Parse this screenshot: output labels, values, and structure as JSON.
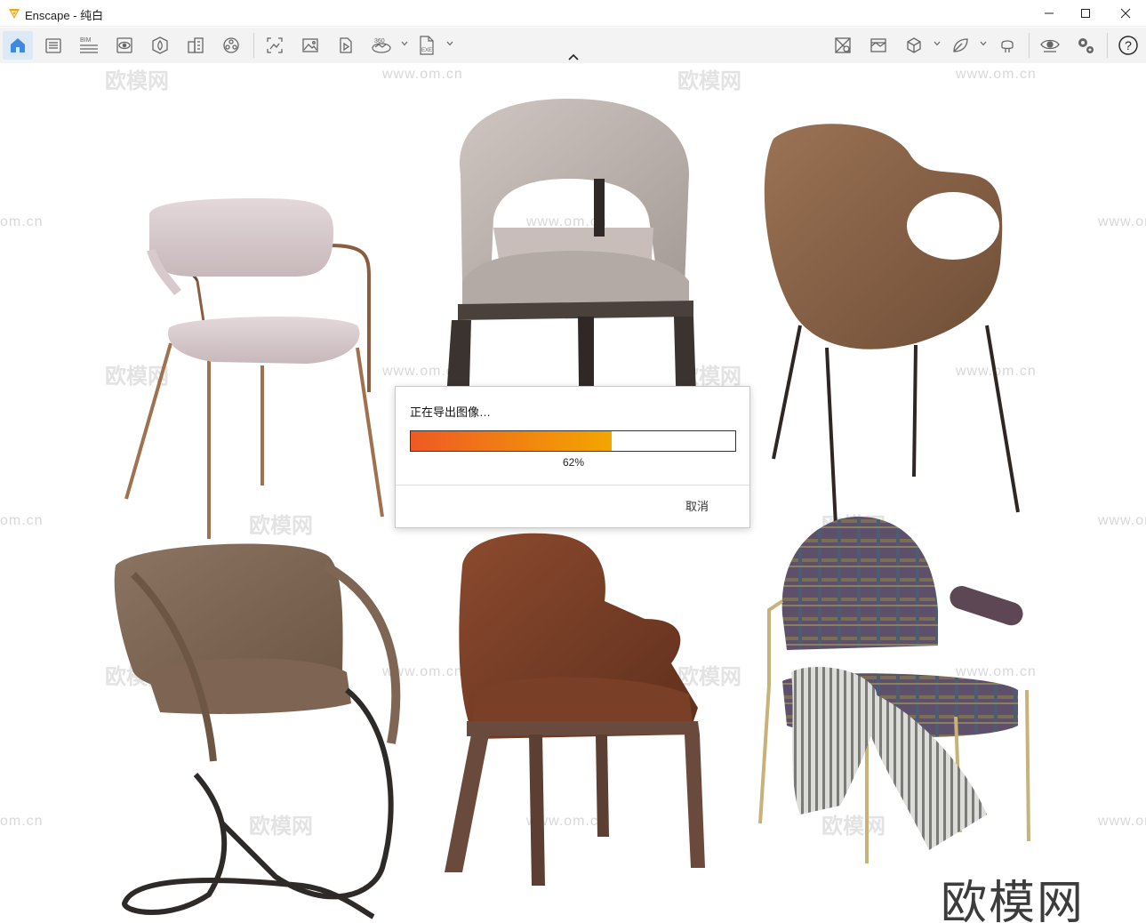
{
  "window": {
    "title": "Enscape - 纯白",
    "controls": [
      "minimize",
      "maximize",
      "close"
    ]
  },
  "toolbar": {
    "left_icons": [
      "home-icon",
      "views-icon",
      "bim-icon",
      "visual-settings-icon",
      "material-editor-icon",
      "site-context-icon",
      "asset-library-icon",
      "screenshot-icon",
      "render-image-icon",
      "video-icon",
      "panorama-360-icon",
      "export-exe-icon"
    ],
    "right_icons": [
      "batch-render-icon",
      "image-map-icon",
      "object-cube-icon",
      "leaf-asset-icon",
      "vr-headset-icon",
      "visibility-eye-icon",
      "settings-gears-icon",
      "help-icon"
    ],
    "bim_label": "BIM",
    "pano_label": "360",
    "exe_label": "EXE"
  },
  "viewport": {
    "watermark_url": "www.om.cn",
    "watermark_short": "om.cn",
    "watermark_cn": "欧模网",
    "brand": "欧模网",
    "chairs": [
      "pink-fabric-chair",
      "grey-leather-armchair",
      "wooden-shell-chair",
      "brown-leather-lounge-chair",
      "cognac-leather-dining-chair",
      "plaid-fabric-chair"
    ]
  },
  "export_dialog": {
    "message": "正在导出图像…",
    "progress_percent": 62,
    "progress_label": "62%",
    "cancel_label": "取消",
    "progress_colors": [
      "#ee5a24",
      "#f3a600"
    ]
  }
}
